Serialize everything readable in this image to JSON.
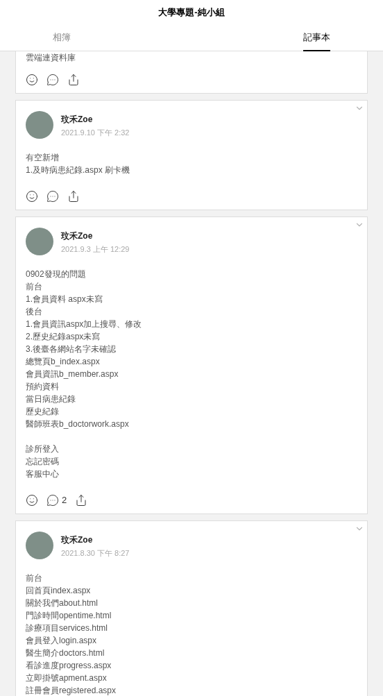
{
  "title": "大學專題-純小組",
  "tabs": [
    {
      "label": "相簿",
      "selected": false
    },
    {
      "label": "記事本",
      "selected": true
    }
  ],
  "notes": [
    {
      "paragraphs": [
        [
          "雲端連資料庫"
        ]
      ]
    },
    {
      "author": "玟禾Zoe",
      "time": "2021.9.10 下午 2:32",
      "paragraphs": [
        [
          "有空新增",
          "1.及時病患紀錄.aspx 刷卡機"
        ]
      ]
    },
    {
      "author": "玟禾Zoe",
      "time": "2021.9.3 上午 12:29",
      "comments": "2",
      "paragraphs": [
        [
          "0902發現的問題",
          "前台",
          "1.會員資料 aspx未寫",
          "後台",
          "1.會員資訊aspx加上搜尋、修改",
          "2.歷史紀錄aspx未寫",
          "3.後臺各網站名字未確認",
          "總覽頁b_index.aspx",
          "會員資訊b_member.aspx",
          "預約資料",
          "當日病患紀錄",
          "歷史紀錄",
          "醫師班表b_doctorwork.aspx"
        ],
        [
          "診所登入",
          "忘記密碼",
          "客服中心"
        ]
      ]
    },
    {
      "author": "玟禾Zoe",
      "time": "2021.8.30 下午 8:27",
      "paragraphs": [
        [
          "前台",
          "回首頁index.aspx",
          "關於我們about.html",
          "門診時間opentime.html",
          "診療項目services.html",
          "會員登入login.aspx",
          "醫生簡介doctors.html",
          "看診進度progress.aspx",
          "立即掛號apment.aspx",
          "註冊會員registered.aspx"
        ]
      ]
    }
  ]
}
